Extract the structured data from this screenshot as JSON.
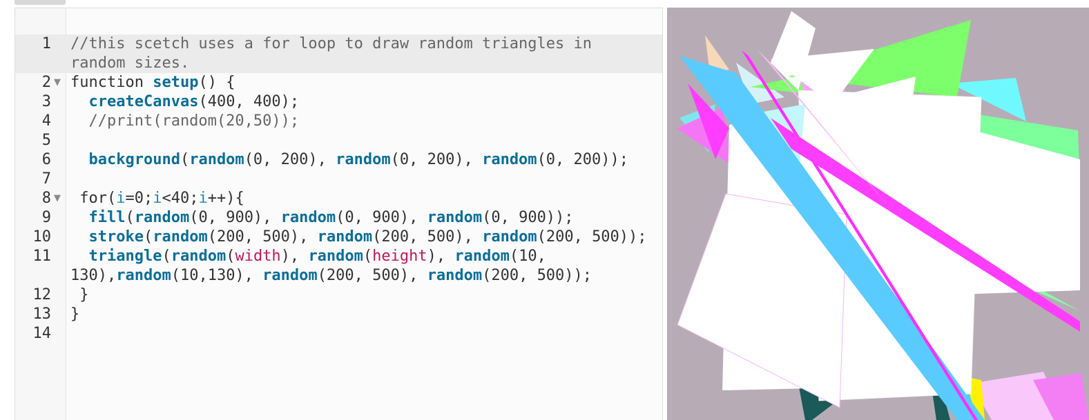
{
  "editor": {
    "lines": [
      {
        "num": "1",
        "fold": "",
        "segments": [
          {
            "cls": "cmt",
            "text": "//this scetch uses a for loop to draw random triangles in"
          }
        ]
      },
      {
        "num": "",
        "fold": "",
        "segments": [
          {
            "cls": "cmt",
            "text": "random sizes."
          }
        ]
      },
      {
        "num": "2",
        "fold": "▼",
        "segments": [
          {
            "cls": "kw",
            "text": "function "
          },
          {
            "cls": "fn",
            "text": "setup"
          },
          {
            "cls": "kw",
            "text": "() {"
          }
        ]
      },
      {
        "num": "3",
        "fold": "",
        "segments": [
          {
            "cls": "kw",
            "text": "  "
          },
          {
            "cls": "fn",
            "text": "createCanvas"
          },
          {
            "cls": "kw",
            "text": "(400, 400);"
          }
        ]
      },
      {
        "num": "4",
        "fold": "",
        "segments": [
          {
            "cls": "cmt",
            "text": "  //print(random(20,50));"
          }
        ]
      },
      {
        "num": "5",
        "fold": "",
        "segments": []
      },
      {
        "num": "6",
        "fold": "",
        "segments": [
          {
            "cls": "kw",
            "text": "  "
          },
          {
            "cls": "fn",
            "text": "background"
          },
          {
            "cls": "kw",
            "text": "("
          },
          {
            "cls": "fn",
            "text": "random"
          },
          {
            "cls": "kw",
            "text": "(0, 200), "
          },
          {
            "cls": "fn",
            "text": "random"
          },
          {
            "cls": "kw",
            "text": "(0, 200), "
          },
          {
            "cls": "fn",
            "text": "random"
          },
          {
            "cls": "kw",
            "text": "(0, 200));"
          }
        ]
      },
      {
        "num": "7",
        "fold": "",
        "segments": []
      },
      {
        "num": "8",
        "fold": "▼",
        "segments": [
          {
            "cls": "kw",
            "text": " for("
          },
          {
            "cls": "var",
            "text": "i"
          },
          {
            "cls": "kw",
            "text": "=0;"
          },
          {
            "cls": "var",
            "text": "i"
          },
          {
            "cls": "kw",
            "text": "<40;"
          },
          {
            "cls": "var",
            "text": "i"
          },
          {
            "cls": "kw",
            "text": "++){"
          }
        ]
      },
      {
        "num": "9",
        "fold": "",
        "segments": [
          {
            "cls": "kw",
            "text": "  "
          },
          {
            "cls": "fn",
            "text": "fill"
          },
          {
            "cls": "kw",
            "text": "("
          },
          {
            "cls": "fn",
            "text": "random"
          },
          {
            "cls": "kw",
            "text": "(0, 900), "
          },
          {
            "cls": "fn",
            "text": "random"
          },
          {
            "cls": "kw",
            "text": "(0, 900), "
          },
          {
            "cls": "fn",
            "text": "random"
          },
          {
            "cls": "kw",
            "text": "(0, 900));"
          }
        ]
      },
      {
        "num": "10",
        "fold": "",
        "segments": [
          {
            "cls": "kw",
            "text": "  "
          },
          {
            "cls": "fn",
            "text": "stroke"
          },
          {
            "cls": "kw",
            "text": "("
          },
          {
            "cls": "fn",
            "text": "random"
          },
          {
            "cls": "kw",
            "text": "(200, 500), "
          },
          {
            "cls": "fn",
            "text": "random"
          },
          {
            "cls": "kw",
            "text": "(200, 500), "
          },
          {
            "cls": "fn",
            "text": "random"
          },
          {
            "cls": "kw",
            "text": "(200, 500));"
          }
        ]
      },
      {
        "num": "11",
        "fold": "",
        "segments": [
          {
            "cls": "kw",
            "text": "  "
          },
          {
            "cls": "fn",
            "text": "triangle"
          },
          {
            "cls": "kw",
            "text": "("
          },
          {
            "cls": "fn",
            "text": "random"
          },
          {
            "cls": "kw",
            "text": "("
          },
          {
            "cls": "prop",
            "text": "width"
          },
          {
            "cls": "kw",
            "text": "), "
          },
          {
            "cls": "fn",
            "text": "random"
          },
          {
            "cls": "kw",
            "text": "("
          },
          {
            "cls": "prop",
            "text": "height"
          },
          {
            "cls": "kw",
            "text": "), "
          },
          {
            "cls": "fn",
            "text": "random"
          },
          {
            "cls": "kw",
            "text": "(10,"
          }
        ]
      },
      {
        "num": "",
        "fold": "",
        "segments": [
          {
            "cls": "kw",
            "text": "130),"
          },
          {
            "cls": "fn",
            "text": "random"
          },
          {
            "cls": "kw",
            "text": "(10,130), "
          },
          {
            "cls": "fn",
            "text": "random"
          },
          {
            "cls": "kw",
            "text": "(200, 500), "
          },
          {
            "cls": "fn",
            "text": "random"
          },
          {
            "cls": "kw",
            "text": "(200, 500));"
          }
        ]
      },
      {
        "num": "12",
        "fold": "",
        "segments": [
          {
            "cls": "kw",
            "text": " }"
          }
        ]
      },
      {
        "num": "13",
        "fold": "",
        "segments": [
          {
            "cls": "kw",
            "text": "}"
          }
        ]
      },
      {
        "num": "14",
        "fold": "",
        "segments": []
      }
    ]
  },
  "preview": {
    "background": "#b7acb6"
  }
}
